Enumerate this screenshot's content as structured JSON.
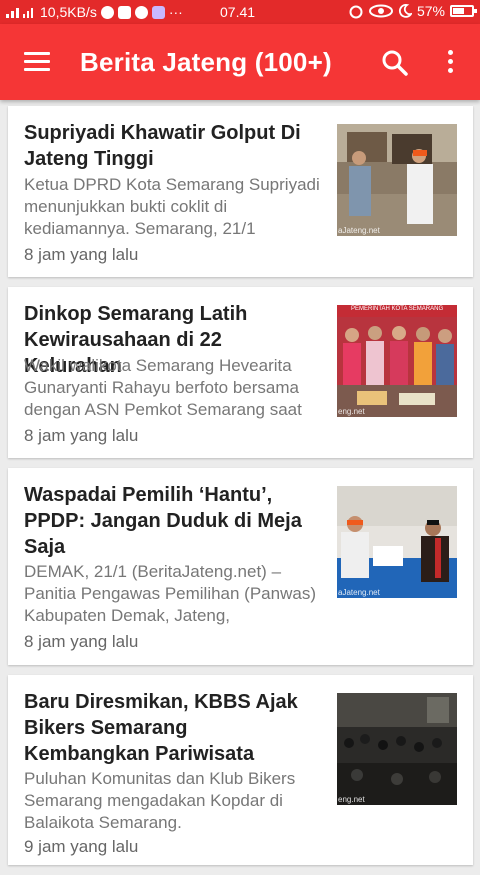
{
  "status_bar": {
    "network": "10,5KB/s",
    "time": "07.41",
    "battery": "57%"
  },
  "app_bar": {
    "title": "Berita Jateng (100+)",
    "menu_icon": "hamburger-menu-icon",
    "search_icon": "search-icon",
    "more_icon": "more-vert-icon"
  },
  "colors": {
    "status_bar": "#e32a2a",
    "app_bar": "#f53636",
    "background": "#ececec"
  },
  "articles": [
    {
      "title": "Supriyadi Khawatir Golput Di Jateng Tinggi",
      "snippet": "Ketua DPRD Kota Semarang Supriyadi menunjukkan bukti coklit di kediamannya. Semarang, 21/1",
      "time": "8 jam yang lalu",
      "watermark": "aJateng.net"
    },
    {
      "title": "Dinkop Semarang Latih Kewirausahaan di 22 Kelurahan",
      "snippet": "Wakil walikota Semarang Hevearita Gunaryanti Rahayu berfoto bersama dengan ASN Pemkot Semarang saat",
      "time": "8 jam yang lalu",
      "banner": "PEMERINTAH KOTA SEMARANG",
      "watermark": "eng.net"
    },
    {
      "title": "Waspadai Pemilih ‘Hantu’, PPDP: Jangan Duduk di Meja Saja",
      "snippet": "DEMAK,  21/1 (BeritaJateng.net) – Panitia Pengawas Pemilihan (Panwas) Kabupaten Demak, Jateng,",
      "time": "8 jam yang lalu",
      "watermark": "aJateng.net"
    },
    {
      "title": "Baru Diresmikan, KBBS Ajak Bikers Semarang Kembangkan Pariwisata",
      "snippet": "Puluhan Komunitas dan Klub Bikers Semarang mengadakan Kopdar di Balaikota Semarang.",
      "time": "9 jam yang lalu",
      "watermark": "eng.net"
    }
  ]
}
